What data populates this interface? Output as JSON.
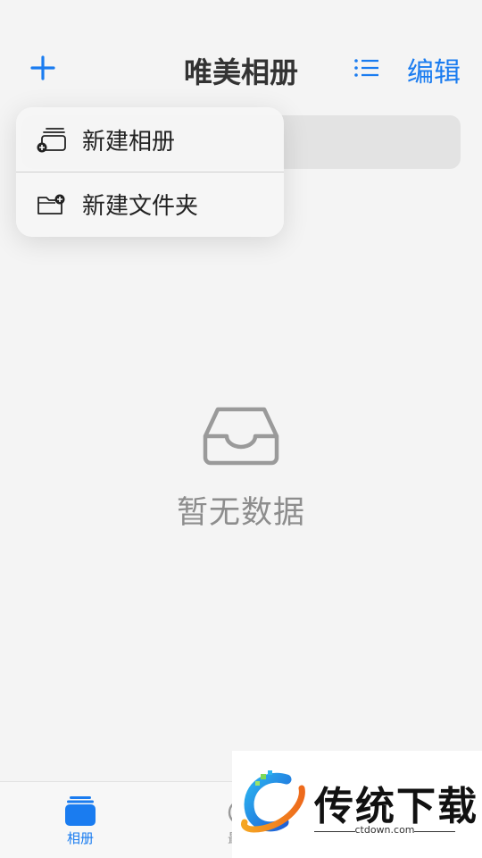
{
  "header": {
    "title": "唯美相册",
    "edit_label": "编辑"
  },
  "menu": {
    "items": [
      {
        "label": "新建相册",
        "icon": "new-album-icon"
      },
      {
        "label": "新建文件夹",
        "icon": "new-folder-icon"
      }
    ]
  },
  "empty_state": {
    "text": "暂无数据",
    "icon": "empty-inbox-icon"
  },
  "tabbar": {
    "tabs": [
      {
        "label": "相册",
        "icon": "album-stack-icon",
        "active": true
      },
      {
        "label": "最近",
        "icon": "clock-icon",
        "active": false
      }
    ]
  },
  "watermark": {
    "brand": "传统下载",
    "site": "ctdown.com"
  },
  "colors": {
    "accent": "#1a7cf0",
    "background": "#f4f4f4",
    "muted_text": "#8d8d8d"
  }
}
